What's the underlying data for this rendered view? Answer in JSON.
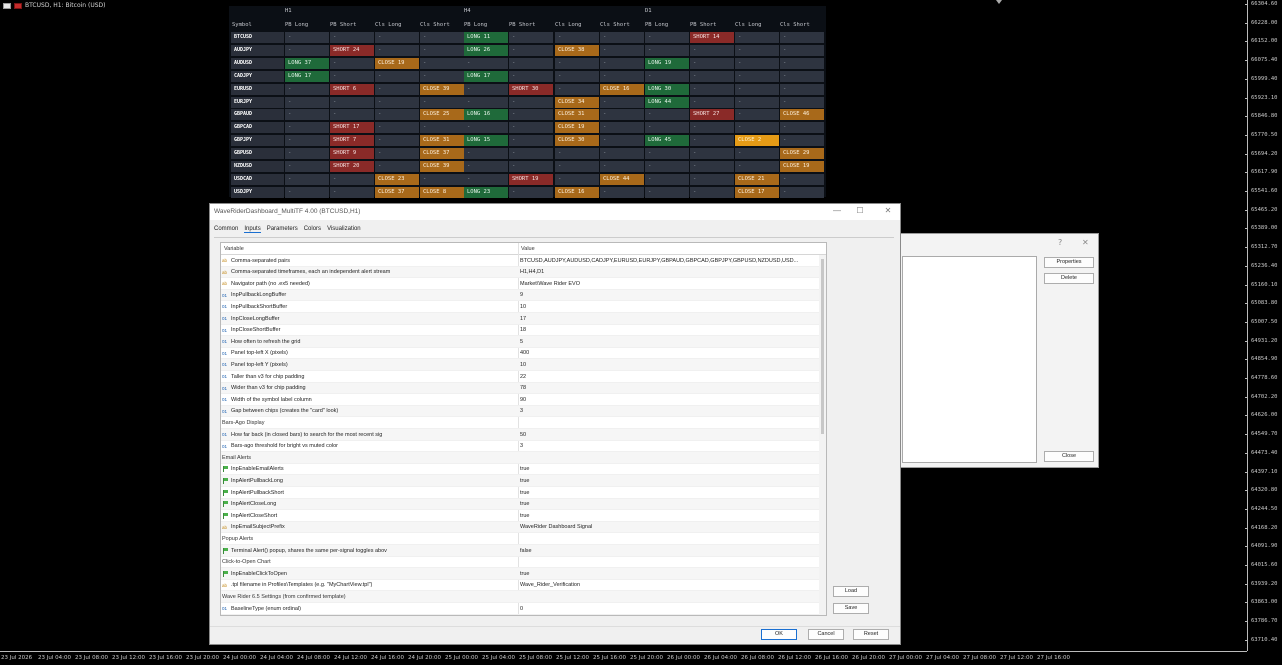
{
  "chart": {
    "title": "BTCUSD, H1: Bitcoin (USD)",
    "prices": [
      "66304.60",
      "66228.00",
      "66152.00",
      "66075.40",
      "65999.40",
      "65923.10",
      "65846.80",
      "65770.50",
      "65694.20",
      "65617.90",
      "65541.60",
      "65465.20",
      "65389.00",
      "65312.70",
      "65236.40",
      "65160.10",
      "65083.80",
      "65007.50",
      "64931.20",
      "64854.90",
      "64778.60",
      "64702.20",
      "64626.00",
      "64549.70",
      "64473.40",
      "64397.10",
      "64320.80",
      "64244.50",
      "64168.20",
      "64091.90",
      "64015.60",
      "63939.20",
      "63863.00",
      "63786.70",
      "63710.40"
    ],
    "times": [
      "23 Jul 2026",
      "23 Jul 04:00",
      "23 Jul 08:00",
      "23 Jul 12:00",
      "23 Jul 16:00",
      "23 Jul 20:00",
      "24 Jul 00:00",
      "24 Jul 04:00",
      "24 Jul 08:00",
      "24 Jul 12:00",
      "24 Jul 16:00",
      "24 Jul 20:00",
      "25 Jul 00:00",
      "25 Jul 04:00",
      "25 Jul 08:00",
      "25 Jul 12:00",
      "25 Jul 16:00",
      "25 Jul 20:00",
      "26 Jul 00:00",
      "26 Jul 04:00",
      "26 Jul 08:00",
      "26 Jul 12:00",
      "26 Jul 16:00",
      "26 Jul 20:00",
      "27 Jul 00:00",
      "27 Jul 04:00",
      "27 Jul 08:00",
      "27 Jul 12:00",
      "27 Jul 16:00"
    ]
  },
  "dashboard": {
    "timeframes": [
      "H1",
      "H4",
      "D1"
    ],
    "symbol_header": "Symbol",
    "col_headers": [
      "PB Long",
      "PB Short",
      "Cls Long",
      "Cls Short"
    ],
    "rows": [
      {
        "sym": "BTCUSD",
        "cells": [
          [
            "-",
            "n"
          ],
          [
            "-",
            "n"
          ],
          [
            "-",
            "n"
          ],
          [
            "-",
            "n"
          ],
          [
            "LONG 11",
            "long"
          ],
          [
            "-",
            "n"
          ],
          [
            "-",
            "n"
          ],
          [
            "-",
            "n"
          ],
          [
            "-",
            "n"
          ],
          [
            "SHORT 14",
            "short"
          ],
          [
            "-",
            "n"
          ],
          [
            "-",
            "n"
          ]
        ]
      },
      {
        "sym": "AUDJPY",
        "cells": [
          [
            "-",
            "n"
          ],
          [
            "SHORT 24",
            "short"
          ],
          [
            "-",
            "n"
          ],
          [
            "-",
            "n"
          ],
          [
            "LONG 26",
            "long"
          ],
          [
            "-",
            "n"
          ],
          [
            "CLOSE 38",
            "close"
          ],
          [
            "-",
            "n"
          ],
          [
            "-",
            "n"
          ],
          [
            "-",
            "n"
          ],
          [
            "-",
            "n"
          ],
          [
            "-",
            "n"
          ]
        ]
      },
      {
        "sym": "AUDUSD",
        "cells": [
          [
            "LONG 37",
            "long"
          ],
          [
            "-",
            "n"
          ],
          [
            "CLOSE 19",
            "close"
          ],
          [
            "-",
            "n"
          ],
          [
            "-",
            "n"
          ],
          [
            "-",
            "n"
          ],
          [
            "-",
            "n"
          ],
          [
            "-",
            "n"
          ],
          [
            "LONG 19",
            "long"
          ],
          [
            "-",
            "n"
          ],
          [
            "-",
            "n"
          ],
          [
            "-",
            "n"
          ]
        ]
      },
      {
        "sym": "CADJPY",
        "cells": [
          [
            "LONG 17",
            "long"
          ],
          [
            "-",
            "n"
          ],
          [
            "-",
            "n"
          ],
          [
            "-",
            "n"
          ],
          [
            "LONG 17",
            "long"
          ],
          [
            "-",
            "n"
          ],
          [
            "-",
            "n"
          ],
          [
            "-",
            "n"
          ],
          [
            "-",
            "n"
          ],
          [
            "-",
            "n"
          ],
          [
            "-",
            "n"
          ],
          [
            "-",
            "n"
          ]
        ]
      },
      {
        "sym": "EURUSD",
        "cells": [
          [
            "-",
            "n"
          ],
          [
            "SHORT 6",
            "short"
          ],
          [
            "-",
            "n"
          ],
          [
            "CLOSE 39",
            "close"
          ],
          [
            "-",
            "n"
          ],
          [
            "SHORT 30",
            "short"
          ],
          [
            "-",
            "n"
          ],
          [
            "CLOSE 16",
            "close"
          ],
          [
            "LONG 30",
            "long"
          ],
          [
            "-",
            "n"
          ],
          [
            "-",
            "n"
          ],
          [
            "-",
            "n"
          ]
        ]
      },
      {
        "sym": "EURJPY",
        "cells": [
          [
            "-",
            "n"
          ],
          [
            "-",
            "n"
          ],
          [
            "-",
            "n"
          ],
          [
            "-",
            "n"
          ],
          [
            "-",
            "n"
          ],
          [
            "-",
            "n"
          ],
          [
            "CLOSE 34",
            "close"
          ],
          [
            "-",
            "n"
          ],
          [
            "LONG 44",
            "long"
          ],
          [
            "-",
            "n"
          ],
          [
            "-",
            "n"
          ],
          [
            "-",
            "n"
          ]
        ]
      },
      {
        "sym": "GBPAUD",
        "cells": [
          [
            "-",
            "n"
          ],
          [
            "-",
            "n"
          ],
          [
            "-",
            "n"
          ],
          [
            "CLOSE 25",
            "close"
          ],
          [
            "LONG 16",
            "long"
          ],
          [
            "-",
            "n"
          ],
          [
            "CLOSE 31",
            "close"
          ],
          [
            "-",
            "n"
          ],
          [
            "-",
            "n"
          ],
          [
            "SHORT 27",
            "short"
          ],
          [
            "-",
            "n"
          ],
          [
            "CLOSE 46",
            "close"
          ]
        ]
      },
      {
        "sym": "GBPCAD",
        "cells": [
          [
            "-",
            "n"
          ],
          [
            "SHORT 17",
            "short"
          ],
          [
            "-",
            "n"
          ],
          [
            "-",
            "n"
          ],
          [
            "-",
            "n"
          ],
          [
            "-",
            "n"
          ],
          [
            "CLOSE 19",
            "close"
          ],
          [
            "-",
            "n"
          ],
          [
            "-",
            "n"
          ],
          [
            "-",
            "n"
          ],
          [
            "-",
            "n"
          ],
          [
            "-",
            "n"
          ]
        ]
      },
      {
        "sym": "GBPJPY",
        "cells": [
          [
            "-",
            "n"
          ],
          [
            "SHORT 7",
            "short"
          ],
          [
            "-",
            "n"
          ],
          [
            "CLOSE 31",
            "close"
          ],
          [
            "LONG 15",
            "long"
          ],
          [
            "-",
            "n"
          ],
          [
            "CLOSE 30",
            "close"
          ],
          [
            "-",
            "n"
          ],
          [
            "LONG 45",
            "long"
          ],
          [
            "-",
            "n"
          ],
          [
            "CLOSE 2",
            "closehot"
          ],
          [
            "-",
            "n"
          ]
        ]
      },
      {
        "sym": "GBPUSD",
        "cells": [
          [
            "-",
            "n"
          ],
          [
            "SHORT 9",
            "short"
          ],
          [
            "-",
            "n"
          ],
          [
            "CLOSE 37",
            "close"
          ],
          [
            "-",
            "n"
          ],
          [
            "-",
            "n"
          ],
          [
            "-",
            "n"
          ],
          [
            "-",
            "n"
          ],
          [
            "-",
            "n"
          ],
          [
            "-",
            "n"
          ],
          [
            "-",
            "n"
          ],
          [
            "CLOSE 29",
            "close"
          ]
        ]
      },
      {
        "sym": "NZDUSD",
        "cells": [
          [
            "-",
            "n"
          ],
          [
            "SHORT 20",
            "short"
          ],
          [
            "-",
            "n"
          ],
          [
            "CLOSE 39",
            "close"
          ],
          [
            "-",
            "n"
          ],
          [
            "-",
            "n"
          ],
          [
            "-",
            "n"
          ],
          [
            "-",
            "n"
          ],
          [
            "-",
            "n"
          ],
          [
            "-",
            "n"
          ],
          [
            "-",
            "n"
          ],
          [
            "CLOSE 19",
            "close"
          ]
        ]
      },
      {
        "sym": "USDCAD",
        "cells": [
          [
            "-",
            "n"
          ],
          [
            "-",
            "n"
          ],
          [
            "CLOSE 23",
            "close"
          ],
          [
            "-",
            "n"
          ],
          [
            "-",
            "n"
          ],
          [
            "SHORT 19",
            "short"
          ],
          [
            "-",
            "n"
          ],
          [
            "CLOSE 44",
            "close"
          ],
          [
            "-",
            "n"
          ],
          [
            "-",
            "n"
          ],
          [
            "CLOSE 21",
            "close"
          ],
          [
            "-",
            "n"
          ]
        ]
      },
      {
        "sym": "USDJPY",
        "cells": [
          [
            "-",
            "n"
          ],
          [
            "-",
            "n"
          ],
          [
            "CLOSE 37",
            "close"
          ],
          [
            "CLOSE 8",
            "close"
          ],
          [
            "LONG 23",
            "long"
          ],
          [
            "-",
            "n"
          ],
          [
            "CLOSE 16",
            "close"
          ],
          [
            "-",
            "n"
          ],
          [
            "-",
            "n"
          ],
          [
            "-",
            "n"
          ],
          [
            "CLOSE 17",
            "close"
          ],
          [
            "-",
            "n"
          ]
        ]
      }
    ]
  },
  "bg_dialog": {
    "help": "?",
    "close_x": "✕",
    "properties": "Properties",
    "delete": "Delete",
    "close": "Close"
  },
  "dialog": {
    "title": "WaveRiderDashboard_MultiTF 4.00 (BTCUSD,H1)",
    "win_min": "—",
    "win_max": "☐",
    "win_close": "✕",
    "tabs": [
      "Common",
      "Inputs",
      "Parameters",
      "Colors",
      "Visualization"
    ],
    "active_tab": 1,
    "grid_header": {
      "variable": "Variable",
      "value": "Value"
    },
    "rows": [
      {
        "t": "ab",
        "name": "Comma-separated pairs",
        "value": "BTCUSD,AUDJPY,AUDUSD,CADJPY,EURUSD,EURJPY,GBPAUD,GBPCAD,GBPJPY,GBPUSD,NZDUSD,USD..."
      },
      {
        "t": "ab",
        "name": "Comma-separated timeframes, each an independent alert stream",
        "value": "H1,H4,D1"
      },
      {
        "t": "ab",
        "name": "Navigator path (no .ex5 needed)",
        "value": "Market\\Wave Rider EVO"
      },
      {
        "t": "01",
        "name": "InpPullbackLongBuffer",
        "value": "9"
      },
      {
        "t": "01",
        "name": "InpPullbackShortBuffer",
        "value": "10"
      },
      {
        "t": "01",
        "name": "InpCloseLongBuffer",
        "value": "17"
      },
      {
        "t": "01",
        "name": "InpCloseShortBuffer",
        "value": "18"
      },
      {
        "t": "01",
        "name": "How often to refresh the grid",
        "value": "5"
      },
      {
        "t": "01",
        "name": "Panel top-left X (pixels)",
        "value": "400"
      },
      {
        "t": "01",
        "name": "Panel top-left Y (pixels)",
        "value": "10"
      },
      {
        "t": "01",
        "name": "Taller than v3 for chip padding",
        "value": "22"
      },
      {
        "t": "01",
        "name": "Wider than v3 for chip padding",
        "value": "78"
      },
      {
        "t": "01",
        "name": "Width of the symbol label column",
        "value": "90"
      },
      {
        "t": "01",
        "name": "Gap between chips (creates the \"card\" look)",
        "value": "3"
      },
      {
        "t": "sect",
        "name": "Bars-Ago Display",
        "value": ""
      },
      {
        "t": "01",
        "name": "How far back (in closed bars) to search for the most recent sig",
        "value": "50"
      },
      {
        "t": "01",
        "name": "Bars-ago threshold for bright vs muted color",
        "value": "3"
      },
      {
        "t": "sect",
        "name": "Email Alerts",
        "value": ""
      },
      {
        "t": "flag",
        "name": "InpEnableEmailAlerts",
        "value": "true"
      },
      {
        "t": "flag",
        "name": "InpAlertPullbackLong",
        "value": "true"
      },
      {
        "t": "flag",
        "name": "InpAlertPullbackShort",
        "value": "true"
      },
      {
        "t": "flag",
        "name": "InpAlertCloseLong",
        "value": "true"
      },
      {
        "t": "flag",
        "name": "InpAlertCloseShort",
        "value": "true"
      },
      {
        "t": "ab",
        "name": "InpEmailSubjectPrefix",
        "value": "WaveRider Dashboard Signal"
      },
      {
        "t": "sect",
        "name": "Popup Alerts",
        "value": ""
      },
      {
        "t": "flag",
        "name": "Terminal Alert() popup, shares the same per-signal toggles abov",
        "value": "false"
      },
      {
        "t": "sect",
        "name": "Click-to-Open Chart",
        "value": ""
      },
      {
        "t": "flag",
        "name": "InpEnableClickToOpen",
        "value": "true"
      },
      {
        "t": "ab",
        "name": ".tpl filename in Profiles\\Templates (e.g. \"MyChartView.tpl\")",
        "value": "Wave_Rider_Verification"
      },
      {
        "t": "sect",
        "name": "Wave Rider 6.5 Settings (from confirmed template)",
        "value": ""
      },
      {
        "t": "01",
        "name": "BaselineType (enum ordinal)",
        "value": "0"
      }
    ],
    "load": "Load",
    "save": "Save",
    "ok": "OK",
    "cancel": "Cancel",
    "reset": "Reset"
  }
}
